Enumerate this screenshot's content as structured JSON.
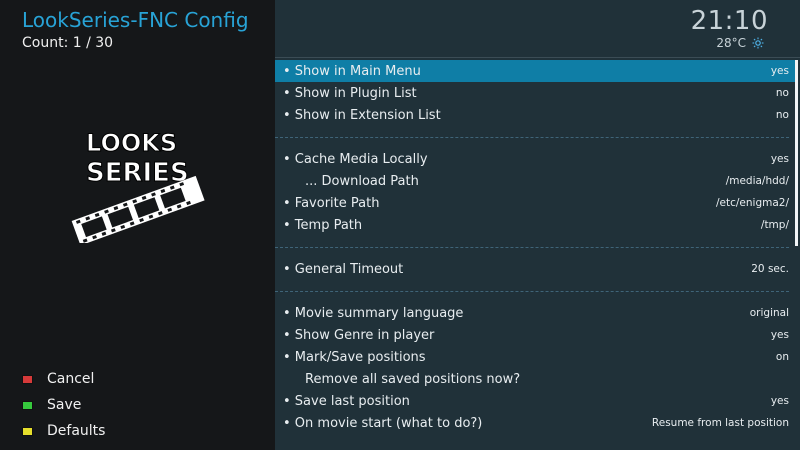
{
  "window": {
    "title": "LookSeries-FNC Config",
    "count": "Count: 1 / 30"
  },
  "status": {
    "time": "21:10",
    "temperature": "28°C",
    "weather_icon": "sun-icon"
  },
  "logo": {
    "text_line1": "LOOKS",
    "text_line2": "SERIES"
  },
  "colors": {
    "accent": "#0f7ea6",
    "title": "#28a3d6",
    "panel": "#203139",
    "cancel": "#d63a3a",
    "save": "#36c93d",
    "defaults": "#e6df2c"
  },
  "settings": [
    {
      "label": "• Show in Main Menu",
      "value": "yes",
      "selected": true
    },
    {
      "label": "• Show in Plugin List",
      "value": "no"
    },
    {
      "label": "• Show in Extension List",
      "value": "no"
    },
    {
      "separator": true
    },
    {
      "label": "• Cache Media Locally",
      "value": "yes"
    },
    {
      "label": "... Download Path",
      "value": "/media/hdd/",
      "sub": true
    },
    {
      "label": "• Favorite Path",
      "value": "/etc/enigma2/"
    },
    {
      "label": "• Temp Path",
      "value": "/tmp/"
    },
    {
      "separator": true
    },
    {
      "label": "• General Timeout",
      "value": "20 sec."
    },
    {
      "separator": true
    },
    {
      "label": "• Movie summary language",
      "value": "original"
    },
    {
      "label": "• Show Genre in player",
      "value": "yes"
    },
    {
      "label": "• Mark/Save positions",
      "value": "on"
    },
    {
      "label": "Remove all saved positions now?",
      "value": "",
      "sub": true
    },
    {
      "label": "• Save last position",
      "value": "yes"
    },
    {
      "label": "• On movie start (what to do?)",
      "value": "Resume from last position"
    }
  ],
  "buttons": [
    {
      "label": "Cancel",
      "color": "#d63a3a"
    },
    {
      "label": "Save",
      "color": "#36c93d"
    },
    {
      "label": "Defaults",
      "color": "#e6df2c"
    }
  ]
}
